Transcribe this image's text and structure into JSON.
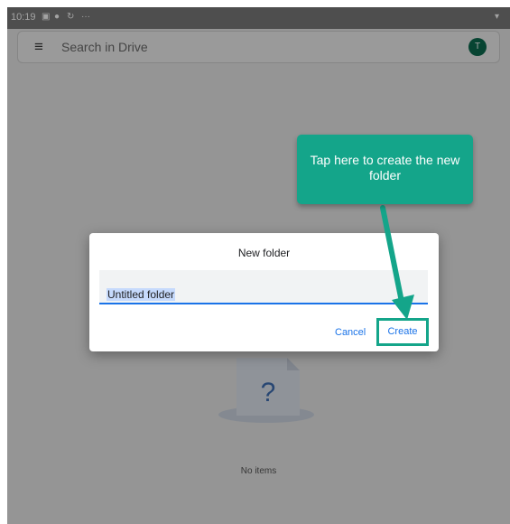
{
  "status_bar": {
    "time": "10:19",
    "icons": [
      "image-icon",
      "shield-icon",
      "sync-icon",
      "more-dots-icon",
      "wifi-icon"
    ],
    "overflow": "···"
  },
  "search_bar": {
    "placeholder": "Search in Drive",
    "avatar_letter": "T",
    "avatar_color": "#0b6b4f"
  },
  "empty_state": {
    "glyph": "?",
    "label": "No items"
  },
  "dialog": {
    "title": "New folder",
    "field_value": "Untitled folder",
    "cancel_label": "Cancel",
    "create_label": "Create"
  },
  "callout": {
    "text": "Tap here to create the new folder",
    "color": "#14a58a"
  },
  "colors": {
    "accent": "#1a73e8",
    "highlight": "#14a58a"
  }
}
